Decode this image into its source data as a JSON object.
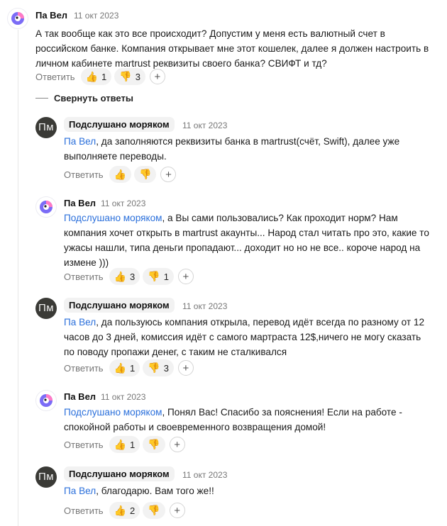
{
  "ui": {
    "reply_label": "Ответить",
    "add_reaction_symbol": "+",
    "collapse_label": "Свернуть ответы"
  },
  "comments": [
    {
      "author": "Па Вел",
      "date": "11 окт 2023",
      "avatar": "pa-vel-avatar",
      "mention": "",
      "text": "А так вообще как это все происходит? Допустим у меня есть валютный счет в российском банке. Компания открывает мне этот кошелек, далее я должен настроить в личном кабинете martrust реквизиты своего банка? СВИФТ и тд?",
      "likes": "1",
      "dislikes": "3"
    },
    {
      "author": "Подслушано моряком",
      "date": "11 окт 2023",
      "avatar_initials": "Пм",
      "mention": "Па Вел",
      "text": ", да заполняются реквизиты банка в martrust(счёт, Swift), далее уже выполняете переводы.",
      "likes": "",
      "dislikes": ""
    },
    {
      "author": "Па Вел",
      "date": "11 окт 2023",
      "avatar": "pa-vel-avatar",
      "mention": "Подслушано моряком",
      "text": ", а Вы сами пользовались? Как проходит норм? Нам компания хочет открыть в martrust акаунты... Народ стал читать про это, какие то ужасы нашли, типа деньги пропадают... доходит но но не все.. короче народ на измене )))",
      "likes": "3",
      "dislikes": "1"
    },
    {
      "author": "Подслушано моряком",
      "date": "11 окт 2023",
      "avatar_initials": "Пм",
      "mention": "Па Вел",
      "text": ", да пользуюсь компания открыла, перевод идёт всегда по разному от 12 часов до 3 дней, комиссия идёт с самого мартраста 12$,ничего не могу сказать по поводу пропажи денег, с таким не сталкивался",
      "likes": "1",
      "dislikes": "3"
    },
    {
      "author": "Па Вел",
      "date": "11 окт 2023",
      "avatar": "pa-vel-avatar",
      "mention": "Подслушано моряком",
      "text": ", Понял Вас! Спасибо за пояснения! Если на работе - спокойной работы и своевременного возвращения домой!",
      "likes": "1",
      "dislikes": ""
    },
    {
      "author": "Подслушано моряком",
      "date": "11 окт 2023",
      "avatar_initials": "Пм",
      "mention": "Па Вел",
      "text": ", благодарю. Вам того же!!",
      "likes": "2",
      "dislikes": ""
    }
  ]
}
